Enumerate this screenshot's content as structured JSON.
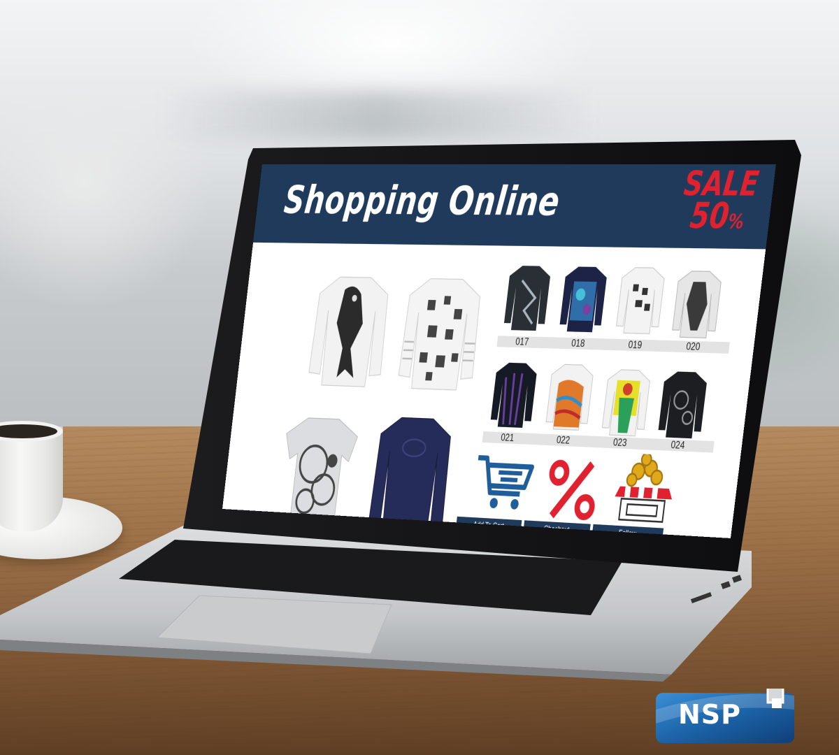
{
  "screen": {
    "title": "Shopping Online",
    "sale_word": "SALE",
    "sale_value": "50",
    "sale_unit": "%",
    "featured_shirts": [
      {
        "icon": "white-raven-longsleeve-shirt"
      },
      {
        "icon": "white-pattern-longsleeve-shirt"
      },
      {
        "icon": "grey-circle-print-tshirt"
      },
      {
        "icon": "navy-longsleeve-shirt"
      }
    ],
    "catalog_rows": [
      {
        "items": [
          {
            "code": "017",
            "icon": "dark-abstract-shirt"
          },
          {
            "code": "018",
            "icon": "blue-pattern-shirt"
          },
          {
            "code": "019",
            "icon": "white-print-shirt"
          },
          {
            "code": "020",
            "icon": "white-grey-print-shirt"
          }
        ]
      },
      {
        "items": [
          {
            "code": "021",
            "icon": "black-striped-shirt"
          },
          {
            "code": "022",
            "icon": "colorful-print-shirt"
          },
          {
            "code": "023",
            "icon": "yellow-print-shirt"
          },
          {
            "code": "024",
            "icon": "black-print-shirt"
          }
        ]
      }
    ],
    "action_icons": [
      "shopping-cart-icon",
      "percent-icon",
      "storefront-coins-icon"
    ],
    "actions": {
      "add_to_cart": "Add To Cart",
      "checkout": "Chachout",
      "follow": "Follow"
    },
    "colors": {
      "header": "#1f3a5b",
      "sale": "#e02230",
      "cart": "#1f5e9a"
    }
  },
  "watermark": {
    "logo_text": "NSP"
  }
}
